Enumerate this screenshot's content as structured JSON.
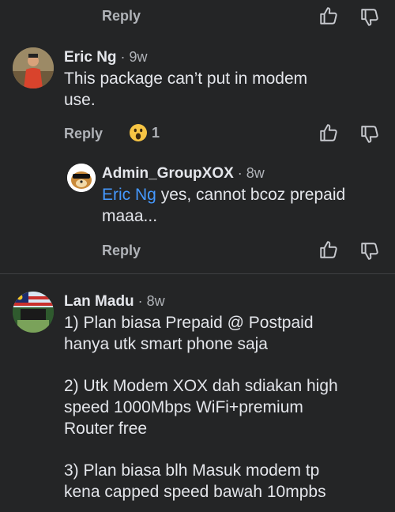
{
  "top": {
    "reply_label": "Reply"
  },
  "comments": [
    {
      "author": "Eric Ng",
      "time": "9w",
      "text_line1": "This package can’t put in modem",
      "text_line2": "use.",
      "reply_label": "Reply",
      "reaction_count": "1",
      "reaction_icon": "wow-emoji-icon"
    },
    {
      "author": "Admin_GroupXOX",
      "time": "8w",
      "mention": "Eric Ng",
      "text_rest": " yes, cannot bcoz prepaid",
      "text_line2": "maaa...",
      "reply_label": "Reply"
    },
    {
      "author": "Lan Madu",
      "time": "8w",
      "paragraphs": [
        [
          "1) Plan biasa Prepaid @ Postpaid",
          "hanya utk smart phone saja"
        ],
        [
          "2) Utk Modem XOX dah sdiakan high",
          "speed 1000Mbps WiFi+premium",
          "Router free"
        ],
        [
          "3) Plan biasa blh Masuk modem tp",
          "kena capped speed bawah 10mpbs"
        ]
      ]
    }
  ],
  "colors": {
    "background": "#242526",
    "text": "#e4e6eb",
    "muted": "#b0b3b8",
    "mention": "#4599ff",
    "divider": "#3e4042"
  }
}
